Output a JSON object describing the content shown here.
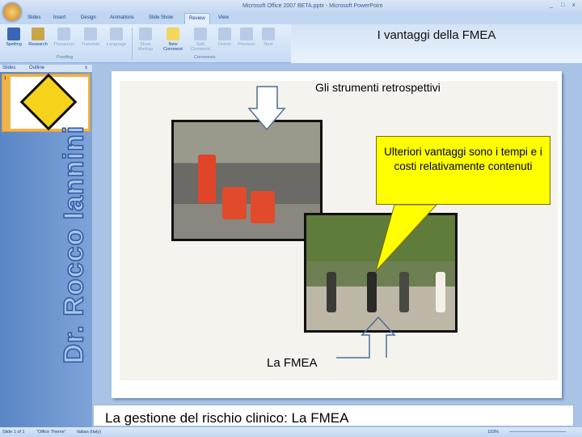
{
  "window": {
    "title": "Microsoft Office 2007 BETA.pptx - Microsoft PowerPoint",
    "controls": [
      "_",
      "□",
      "x"
    ]
  },
  "tabs": [
    "Slides",
    "Insert",
    "Design",
    "Animations",
    "Slide Show",
    "Review",
    "View"
  ],
  "ribbon": {
    "buttons": [
      "Spelling",
      "Research",
      "Thesaurus",
      "Translate",
      "Language",
      "Show Markup",
      "New Comment",
      "Edit Comment",
      "Delete",
      "Previous",
      "Next"
    ],
    "groups": [
      "Proofing",
      "Comments"
    ]
  },
  "header_title": "I vantaggi della FMEA",
  "panel": {
    "tabs": [
      "Slides",
      "Outline"
    ],
    "close": "x",
    "slide_number": "1"
  },
  "vertical_text": "Dr. Rocco Iannini",
  "slide": {
    "title": "Gli strumenti retrospettivi",
    "callout": "Ulteriori vantaggi sono i tempi e i costi relativamente contenuti",
    "label": "La FMEA"
  },
  "notes": "La gestione del rischio clinico: La FMEA",
  "status": {
    "slide": "Slide 1 of 1",
    "theme": "\"Office Theme\"",
    "language": "Italian (Italy)",
    "zoom": "103%"
  }
}
